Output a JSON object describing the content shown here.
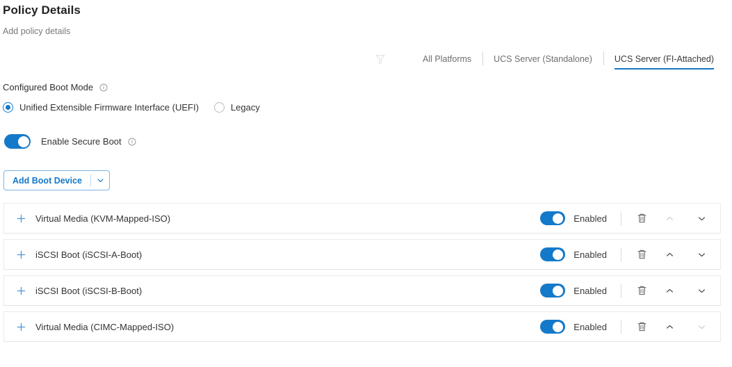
{
  "header": {
    "title": "Policy Details",
    "subtitle": "Add policy details"
  },
  "platform_filter": {
    "filter_icon": "filter-icon",
    "tabs": [
      {
        "label": "All Platforms",
        "active": false
      },
      {
        "label": "UCS Server (Standalone)",
        "active": false
      },
      {
        "label": "UCS Server (FI-Attached)",
        "active": true
      }
    ]
  },
  "boot_mode": {
    "label": "Configured Boot Mode",
    "info_icon": "info-icon",
    "options": [
      {
        "label": "Unified Extensible Firmware Interface (UEFI)",
        "selected": true
      },
      {
        "label": "Legacy",
        "selected": false
      }
    ]
  },
  "secure_boot": {
    "label": "Enable Secure Boot",
    "enabled": true,
    "info_icon": "info-icon"
  },
  "add_boot_device": {
    "label": "Add Boot Device",
    "caret_icon": "chevron-down-icon"
  },
  "boot_devices": {
    "enabled_label": "Enabled",
    "expand_icon": "plus-icon",
    "delete_icon": "trash-icon",
    "move_up_icon": "chevron-up-icon",
    "move_down_icon": "chevron-down-icon",
    "rows": [
      {
        "name": "Virtual Media (KVM-Mapped-ISO)",
        "enabled": true,
        "status": "Enabled",
        "can_move_up": false,
        "can_move_down": true
      },
      {
        "name": "iSCSI Boot (iSCSI-A-Boot)",
        "enabled": true,
        "status": "Enabled",
        "can_move_up": true,
        "can_move_down": true
      },
      {
        "name": "iSCSI Boot (iSCSI-B-Boot)",
        "enabled": true,
        "status": "Enabled",
        "can_move_up": true,
        "can_move_down": true
      },
      {
        "name": "Virtual Media (CIMC-Mapped-ISO)",
        "enabled": true,
        "status": "Enabled",
        "can_move_up": true,
        "can_move_down": false
      }
    ]
  },
  "colors": {
    "accent_blue": "#1479c9",
    "plus_blue": "#4c97d8",
    "text_dark": "#333333",
    "text_muted": "#7a7a7a",
    "border": "#e4e4e4"
  }
}
